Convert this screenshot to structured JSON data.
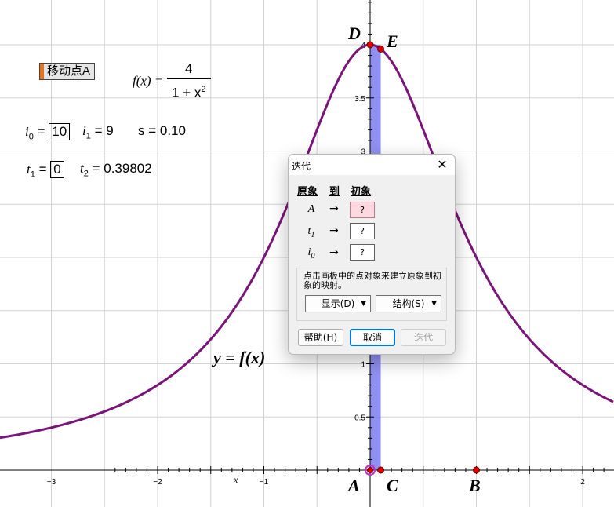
{
  "canvas": {
    "function_label": "f(x) =",
    "fraction_numerator": "4",
    "fraction_denominator_base": "1 + x",
    "fraction_denominator_exp": "2",
    "action_button": "移动点A",
    "i0_label": "i",
    "i0_sub": "0",
    "i0_value": "10",
    "i1_label": "i",
    "i1_sub": "1",
    "i1_value": "= 9",
    "s_text": "s = 0.10",
    "t1_label": "t",
    "t1_sub": "1",
    "t1_value": "0",
    "t2_label": "t",
    "t2_sub": "2",
    "t2_value": "= 0.39802",
    "curve_label": "y = f(x)",
    "point_labels": {
      "A": "A",
      "B": "B",
      "C": "C",
      "D": "D",
      "E": "E"
    },
    "x_axis_label": "x",
    "x_tick_labels": [
      "−3",
      "−2",
      "−1",
      "2"
    ],
    "y_tick_labels": [
      "0.5",
      "1",
      "3",
      "3.5",
      "4"
    ],
    "points": {
      "A": [
        0,
        0
      ],
      "B": [
        1,
        0
      ],
      "C": [
        0.1,
        0
      ],
      "D": [
        0,
        4
      ],
      "E": [
        0.1,
        3.96
      ]
    },
    "colors": {
      "curve": "#7b137b",
      "shade": "#7c7cf0",
      "point": "#e00000",
      "accent": "#e8731d"
    }
  },
  "dialog": {
    "title": "迭代",
    "close_icon": "✕",
    "col_source": "原象",
    "col_to": "到",
    "col_target": "初象",
    "rows": [
      {
        "src": "A",
        "sub": "",
        "arrow": "→",
        "target": "?"
      },
      {
        "src": "t",
        "sub": "1",
        "arrow": "→",
        "target": "?"
      },
      {
        "src": "i",
        "sub": "0",
        "arrow": "→",
        "target": "?"
      }
    ],
    "hint": "点击画板中的点对象来建立原象到初象的映射。",
    "display_dropdown": "显示(D)",
    "structure_dropdown": "结构(S)",
    "help_button": "帮助(H)",
    "cancel_button": "取消",
    "iterate_button": "迭代"
  }
}
